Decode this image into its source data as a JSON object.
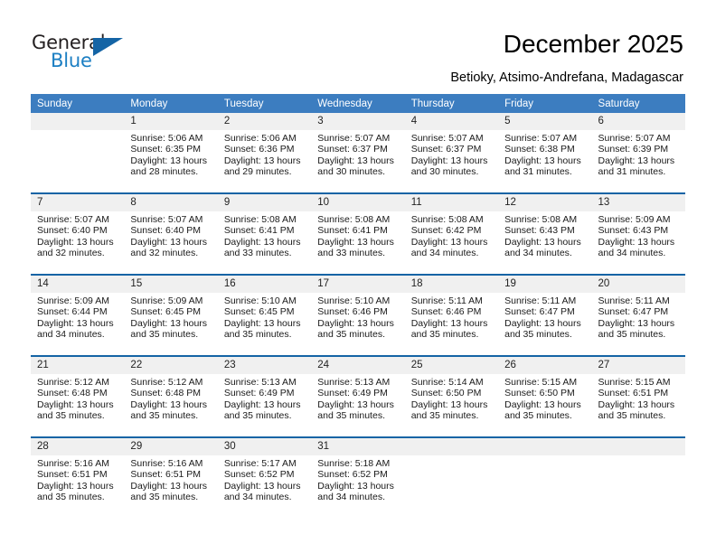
{
  "brand": {
    "name_top": "General",
    "name_bottom": "Blue",
    "color_dark": "#231f20",
    "color_blue": "#1c7fc3",
    "triangle_color": "#1464a5"
  },
  "header": {
    "title": "December 2025",
    "location": "Betioky, Atsimo-Andrefana, Madagascar"
  },
  "theme": {
    "header_bg": "#3c7dc0",
    "week_separator": "#1464a5",
    "daynum_bg": "#f0f0f0"
  },
  "weekday_headers": [
    "Sunday",
    "Monday",
    "Tuesday",
    "Wednesday",
    "Thursday",
    "Friday",
    "Saturday"
  ],
  "weeks": [
    [
      {
        "day": "",
        "sunrise": "",
        "sunset": "",
        "daylight_line1": "",
        "daylight_line2": ""
      },
      {
        "day": "1",
        "sunrise": "Sunrise: 5:06 AM",
        "sunset": "Sunset: 6:35 PM",
        "daylight_line1": "Daylight: 13 hours",
        "daylight_line2": "and 28 minutes."
      },
      {
        "day": "2",
        "sunrise": "Sunrise: 5:06 AM",
        "sunset": "Sunset: 6:36 PM",
        "daylight_line1": "Daylight: 13 hours",
        "daylight_line2": "and 29 minutes."
      },
      {
        "day": "3",
        "sunrise": "Sunrise: 5:07 AM",
        "sunset": "Sunset: 6:37 PM",
        "daylight_line1": "Daylight: 13 hours",
        "daylight_line2": "and 30 minutes."
      },
      {
        "day": "4",
        "sunrise": "Sunrise: 5:07 AM",
        "sunset": "Sunset: 6:37 PM",
        "daylight_line1": "Daylight: 13 hours",
        "daylight_line2": "and 30 minutes."
      },
      {
        "day": "5",
        "sunrise": "Sunrise: 5:07 AM",
        "sunset": "Sunset: 6:38 PM",
        "daylight_line1": "Daylight: 13 hours",
        "daylight_line2": "and 31 minutes."
      },
      {
        "day": "6",
        "sunrise": "Sunrise: 5:07 AM",
        "sunset": "Sunset: 6:39 PM",
        "daylight_line1": "Daylight: 13 hours",
        "daylight_line2": "and 31 minutes."
      }
    ],
    [
      {
        "day": "7",
        "sunrise": "Sunrise: 5:07 AM",
        "sunset": "Sunset: 6:40 PM",
        "daylight_line1": "Daylight: 13 hours",
        "daylight_line2": "and 32 minutes."
      },
      {
        "day": "8",
        "sunrise": "Sunrise: 5:07 AM",
        "sunset": "Sunset: 6:40 PM",
        "daylight_line1": "Daylight: 13 hours",
        "daylight_line2": "and 32 minutes."
      },
      {
        "day": "9",
        "sunrise": "Sunrise: 5:08 AM",
        "sunset": "Sunset: 6:41 PM",
        "daylight_line1": "Daylight: 13 hours",
        "daylight_line2": "and 33 minutes."
      },
      {
        "day": "10",
        "sunrise": "Sunrise: 5:08 AM",
        "sunset": "Sunset: 6:41 PM",
        "daylight_line1": "Daylight: 13 hours",
        "daylight_line2": "and 33 minutes."
      },
      {
        "day": "11",
        "sunrise": "Sunrise: 5:08 AM",
        "sunset": "Sunset: 6:42 PM",
        "daylight_line1": "Daylight: 13 hours",
        "daylight_line2": "and 34 minutes."
      },
      {
        "day": "12",
        "sunrise": "Sunrise: 5:08 AM",
        "sunset": "Sunset: 6:43 PM",
        "daylight_line1": "Daylight: 13 hours",
        "daylight_line2": "and 34 minutes."
      },
      {
        "day": "13",
        "sunrise": "Sunrise: 5:09 AM",
        "sunset": "Sunset: 6:43 PM",
        "daylight_line1": "Daylight: 13 hours",
        "daylight_line2": "and 34 minutes."
      }
    ],
    [
      {
        "day": "14",
        "sunrise": "Sunrise: 5:09 AM",
        "sunset": "Sunset: 6:44 PM",
        "daylight_line1": "Daylight: 13 hours",
        "daylight_line2": "and 34 minutes."
      },
      {
        "day": "15",
        "sunrise": "Sunrise: 5:09 AM",
        "sunset": "Sunset: 6:45 PM",
        "daylight_line1": "Daylight: 13 hours",
        "daylight_line2": "and 35 minutes."
      },
      {
        "day": "16",
        "sunrise": "Sunrise: 5:10 AM",
        "sunset": "Sunset: 6:45 PM",
        "daylight_line1": "Daylight: 13 hours",
        "daylight_line2": "and 35 minutes."
      },
      {
        "day": "17",
        "sunrise": "Sunrise: 5:10 AM",
        "sunset": "Sunset: 6:46 PM",
        "daylight_line1": "Daylight: 13 hours",
        "daylight_line2": "and 35 minutes."
      },
      {
        "day": "18",
        "sunrise": "Sunrise: 5:11 AM",
        "sunset": "Sunset: 6:46 PM",
        "daylight_line1": "Daylight: 13 hours",
        "daylight_line2": "and 35 minutes."
      },
      {
        "day": "19",
        "sunrise": "Sunrise: 5:11 AM",
        "sunset": "Sunset: 6:47 PM",
        "daylight_line1": "Daylight: 13 hours",
        "daylight_line2": "and 35 minutes."
      },
      {
        "day": "20",
        "sunrise": "Sunrise: 5:11 AM",
        "sunset": "Sunset: 6:47 PM",
        "daylight_line1": "Daylight: 13 hours",
        "daylight_line2": "and 35 minutes."
      }
    ],
    [
      {
        "day": "21",
        "sunrise": "Sunrise: 5:12 AM",
        "sunset": "Sunset: 6:48 PM",
        "daylight_line1": "Daylight: 13 hours",
        "daylight_line2": "and 35 minutes."
      },
      {
        "day": "22",
        "sunrise": "Sunrise: 5:12 AM",
        "sunset": "Sunset: 6:48 PM",
        "daylight_line1": "Daylight: 13 hours",
        "daylight_line2": "and 35 minutes."
      },
      {
        "day": "23",
        "sunrise": "Sunrise: 5:13 AM",
        "sunset": "Sunset: 6:49 PM",
        "daylight_line1": "Daylight: 13 hours",
        "daylight_line2": "and 35 minutes."
      },
      {
        "day": "24",
        "sunrise": "Sunrise: 5:13 AM",
        "sunset": "Sunset: 6:49 PM",
        "daylight_line1": "Daylight: 13 hours",
        "daylight_line2": "and 35 minutes."
      },
      {
        "day": "25",
        "sunrise": "Sunrise: 5:14 AM",
        "sunset": "Sunset: 6:50 PM",
        "daylight_line1": "Daylight: 13 hours",
        "daylight_line2": "and 35 minutes."
      },
      {
        "day": "26",
        "sunrise": "Sunrise: 5:15 AM",
        "sunset": "Sunset: 6:50 PM",
        "daylight_line1": "Daylight: 13 hours",
        "daylight_line2": "and 35 minutes."
      },
      {
        "day": "27",
        "sunrise": "Sunrise: 5:15 AM",
        "sunset": "Sunset: 6:51 PM",
        "daylight_line1": "Daylight: 13 hours",
        "daylight_line2": "and 35 minutes."
      }
    ],
    [
      {
        "day": "28",
        "sunrise": "Sunrise: 5:16 AM",
        "sunset": "Sunset: 6:51 PM",
        "daylight_line1": "Daylight: 13 hours",
        "daylight_line2": "and 35 minutes."
      },
      {
        "day": "29",
        "sunrise": "Sunrise: 5:16 AM",
        "sunset": "Sunset: 6:51 PM",
        "daylight_line1": "Daylight: 13 hours",
        "daylight_line2": "and 35 minutes."
      },
      {
        "day": "30",
        "sunrise": "Sunrise: 5:17 AM",
        "sunset": "Sunset: 6:52 PM",
        "daylight_line1": "Daylight: 13 hours",
        "daylight_line2": "and 34 minutes."
      },
      {
        "day": "31",
        "sunrise": "Sunrise: 5:18 AM",
        "sunset": "Sunset: 6:52 PM",
        "daylight_line1": "Daylight: 13 hours",
        "daylight_line2": "and 34 minutes."
      },
      {
        "day": "",
        "sunrise": "",
        "sunset": "",
        "daylight_line1": "",
        "daylight_line2": ""
      },
      {
        "day": "",
        "sunrise": "",
        "sunset": "",
        "daylight_line1": "",
        "daylight_line2": ""
      },
      {
        "day": "",
        "sunrise": "",
        "sunset": "",
        "daylight_line1": "",
        "daylight_line2": ""
      }
    ]
  ]
}
